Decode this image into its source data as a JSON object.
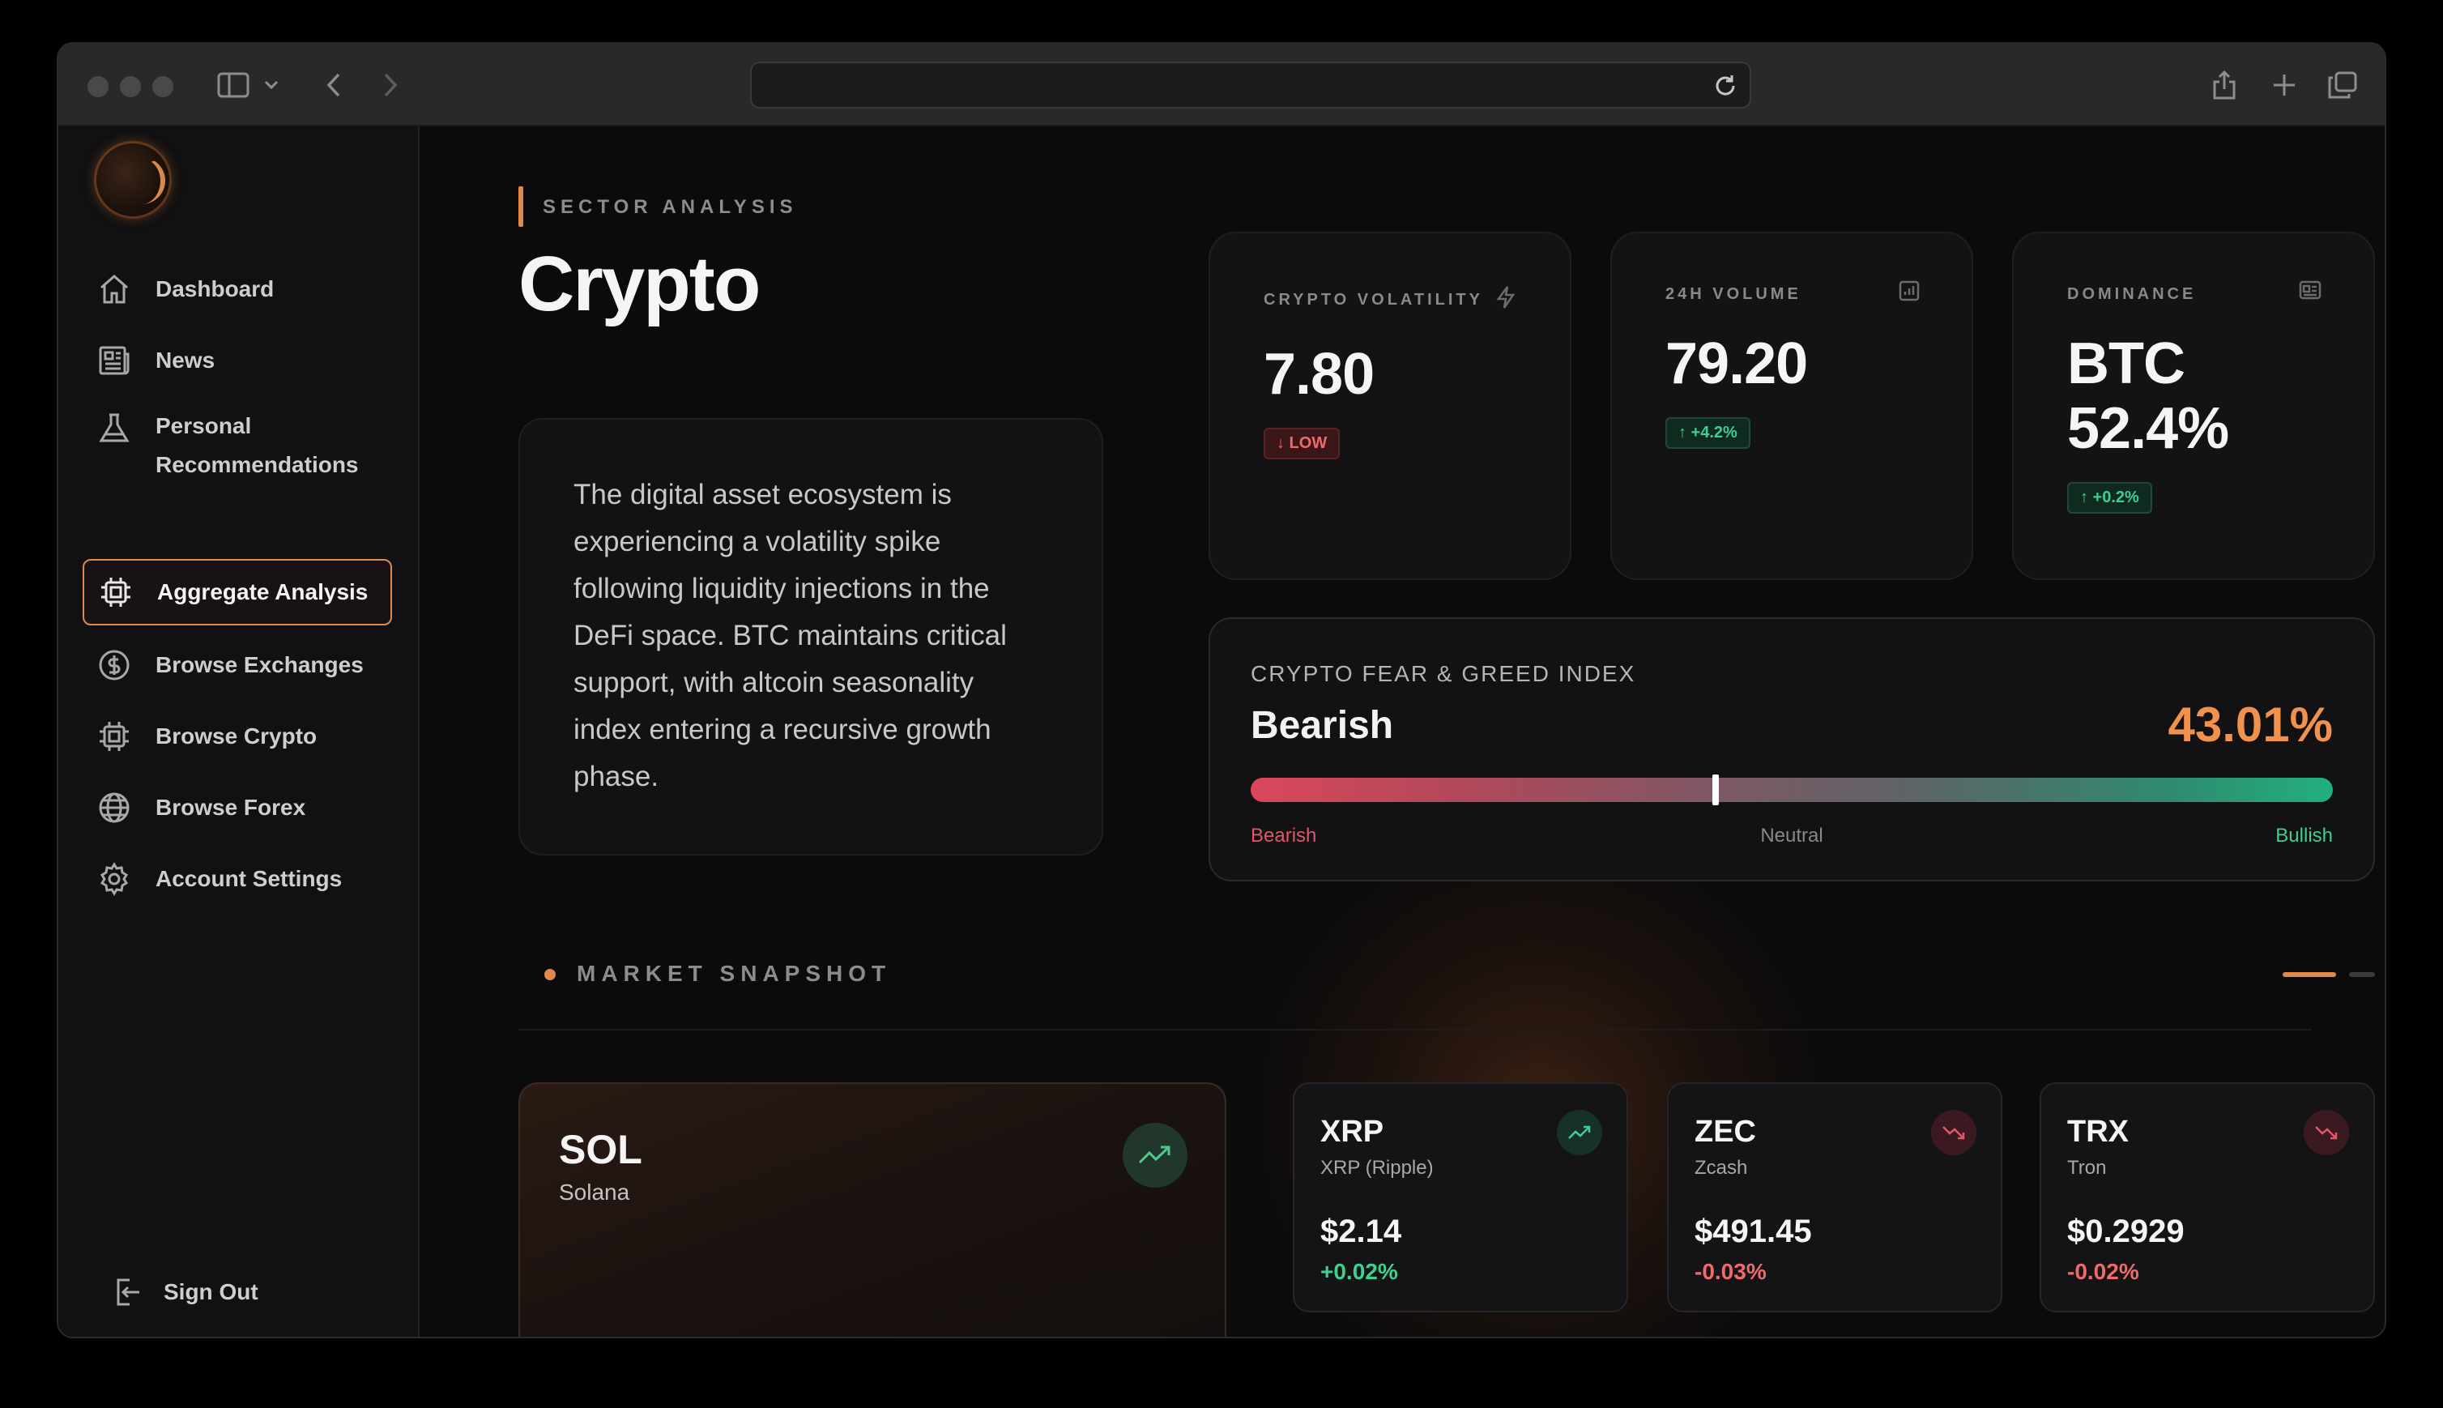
{
  "sidebar": {
    "items": [
      {
        "label": "Dashboard",
        "icon": "home-icon"
      },
      {
        "label": "News",
        "icon": "newspaper-icon"
      },
      {
        "label": "Personal Recommendations",
        "icon": "flask-icon"
      },
      {
        "label": "Aggregate Analysis",
        "icon": "chip-icon",
        "active": true
      },
      {
        "label": "Browse Exchanges",
        "icon": "dollar-circle-icon"
      },
      {
        "label": "Browse Crypto",
        "icon": "chip-icon"
      },
      {
        "label": "Browse Forex",
        "icon": "globe-icon"
      },
      {
        "label": "Account Settings",
        "icon": "gear-icon"
      }
    ],
    "sign_out": "Sign Out"
  },
  "header": {
    "section_label": "SECTOR ANALYSIS",
    "title": "Crypto"
  },
  "description": "The digital asset ecosystem is experiencing a volatility spike following liquidity injections in the DeFi space. BTC maintains critical support, with altcoin seasonality index entering a recursive growth phase.",
  "stats": [
    {
      "label": "CRYPTO VOLATILITY",
      "value": "7.80",
      "badge": "↓ LOW",
      "trend": "down",
      "icon": "bolt-icon"
    },
    {
      "label": "24H VOLUME",
      "value": "79.20",
      "badge": "↑ +4.2%",
      "trend": "up",
      "icon": "bar-chart-icon"
    },
    {
      "label": "DOMINANCE",
      "value_line1": "BTC",
      "value_line2": "52.4%",
      "badge": "↑ +0.2%",
      "trend": "up",
      "icon": "id-card-icon"
    }
  ],
  "fear_greed": {
    "title": "CRYPTO FEAR & GREED INDEX",
    "sentiment": "Bearish",
    "value": "43.01%",
    "level": 0.43,
    "scale": {
      "low": "Bearish",
      "mid": "Neutral",
      "high": "Bullish"
    }
  },
  "market_snapshot": {
    "label": "MARKET SNAPSHOT",
    "featured": {
      "symbol": "SOL",
      "name": "Solana",
      "trend": "up"
    },
    "coins": [
      {
        "symbol": "XRP",
        "name": "XRP (Ripple)",
        "price": "$2.14",
        "change": "+0.02%",
        "trend": "up"
      },
      {
        "symbol": "ZEC",
        "name": "Zcash",
        "price": "$491.45",
        "change": "-0.03%",
        "trend": "down"
      },
      {
        "symbol": "TRX",
        "name": "Tron",
        "price": "$0.2929",
        "change": "-0.02%",
        "trend": "down"
      }
    ]
  },
  "colors": {
    "accent": "#e0894a",
    "positive": "#3fcf8e",
    "negative": "#f06a6a"
  }
}
